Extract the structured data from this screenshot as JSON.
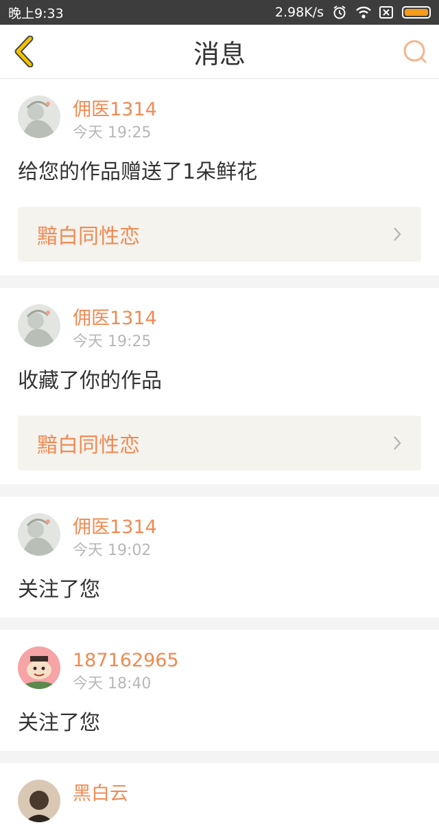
{
  "status_bar": {
    "time": "晚上9:33",
    "speed": "2.98K/s",
    "icons": [
      "alarm-icon",
      "wifi-icon",
      "no-sim-icon",
      "battery-icon"
    ]
  },
  "header": {
    "title": "消息",
    "back_icon": "back-chevron-icon",
    "search_icon": "search-icon"
  },
  "colors": {
    "accent": "#f08a52",
    "back_icon": "#f2c400",
    "search_icon": "#f7b38c",
    "time_text": "#b7b7b7",
    "work_box_bg": "#f4f3ee"
  },
  "messages": [
    {
      "username": "佣医1314",
      "time": "今天 19:25",
      "text": "给您的作品赠送了1朵鲜花",
      "work_title": "黯白同性恋"
    },
    {
      "username": "佣医1314",
      "time": "今天 19:25",
      "text": "收藏了你的作品",
      "work_title": "黯白同性恋"
    },
    {
      "username": "佣医1314",
      "time": "今天 19:02",
      "text": "关注了您"
    },
    {
      "username": "187162965",
      "time": "今天 18:40",
      "text": "关注了您"
    },
    {
      "username": "黑白云"
    }
  ]
}
